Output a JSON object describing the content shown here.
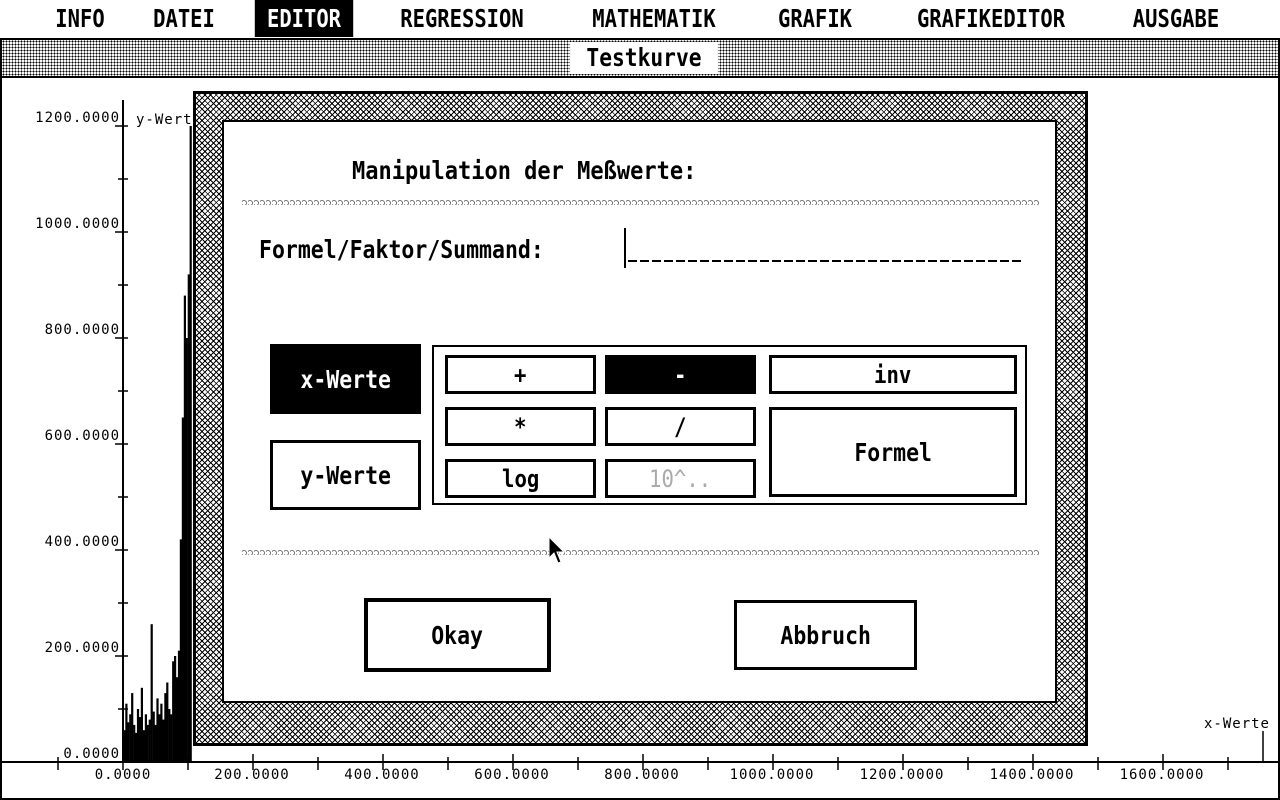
{
  "menubar": {
    "items": [
      {
        "label": "INFO",
        "active": false
      },
      {
        "label": "DATEI",
        "active": false
      },
      {
        "label": "EDITOR",
        "active": true
      },
      {
        "label": "REGRESSION",
        "active": false
      },
      {
        "label": "MATHEMATIK",
        "active": false
      },
      {
        "label": "GRAFIK",
        "active": false
      },
      {
        "label": "GRAFIKEDITOR",
        "active": false
      },
      {
        "label": "AUSGABE",
        "active": false
      }
    ]
  },
  "window": {
    "title": "Testkurve"
  },
  "chart_data": {
    "type": "bar",
    "ylabel": "y-Werte",
    "xlabel": "x-Werte",
    "xlim": [
      0,
      1750
    ],
    "ylim": [
      0,
      1200
    ],
    "y_ticks": [
      "0.0000",
      "200.0000",
      "400.0000",
      "600.0000",
      "800.0000",
      "1000.0000",
      "1200.0000"
    ],
    "x_ticks": [
      "0.0000",
      "200.0000",
      "400.0000",
      "600.0000",
      "800.0000",
      "1000.0000",
      "1200.0000",
      "1400.0000",
      "1600.0000"
    ],
    "x": [
      2,
      5,
      8,
      11,
      14,
      17,
      20,
      23,
      26,
      29,
      32,
      35,
      38,
      41,
      44,
      47,
      50,
      53,
      56,
      59,
      62,
      65,
      68,
      71,
      74,
      77,
      80,
      83,
      86,
      89,
      92,
      95,
      98,
      101,
      104
    ],
    "values": [
      60,
      110,
      75,
      90,
      130,
      70,
      55,
      100,
      85,
      140,
      60,
      90,
      70,
      80,
      260,
      95,
      70,
      120,
      90,
      110,
      80,
      130,
      150,
      100,
      90,
      190,
      200,
      160,
      210,
      420,
      650,
      880,
      800,
      920,
      1200
    ]
  },
  "dialog": {
    "heading": "Manipulation der Meßwerte:",
    "formula_label": "Formel/Faktor/Summand:",
    "formula_value": "",
    "target_buttons": [
      {
        "label": "x-Werte",
        "selected": true
      },
      {
        "label": "y-Werte",
        "selected": false
      }
    ],
    "op_buttons": {
      "plus": {
        "label": "+",
        "selected": false
      },
      "minus": {
        "label": "-",
        "selected": true
      },
      "inv": {
        "label": "inv",
        "selected": false
      },
      "mul": {
        "label": "*",
        "selected": false
      },
      "div": {
        "label": "/",
        "selected": false
      },
      "formel": {
        "label": "Formel",
        "selected": false
      },
      "log": {
        "label": "log",
        "selected": false
      },
      "pow10": {
        "label": "10^..",
        "selected": false,
        "disabled": true
      }
    },
    "ok_label": "Okay",
    "cancel_label": "Abbruch"
  }
}
